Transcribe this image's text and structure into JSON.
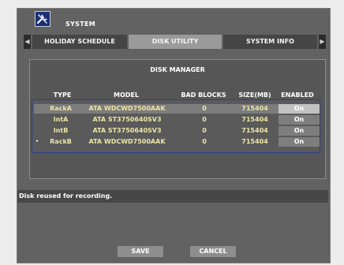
{
  "window": {
    "title": "SYSTEM",
    "icon": "tools-icon"
  },
  "tabs": [
    {
      "label": "◀",
      "icon": "tab-scroll-left-icon"
    },
    {
      "label": "HOLIDAY SCHEDULE"
    },
    {
      "label": "DISK UTILITY",
      "active": true
    },
    {
      "label": "SYSTEM INFO"
    },
    {
      "label": "▶",
      "icon": "tab-scroll-right-icon"
    }
  ],
  "panel": {
    "title": "DISK MANAGER"
  },
  "table": {
    "columns": [
      "TYPE",
      "MODEL",
      "BAD BLOCKS",
      "SIZE(MB)",
      "ENABLED"
    ],
    "rows": [
      {
        "type": "RackA",
        "model": "ATA WDCWD7500AAK",
        "bad_blocks": "0",
        "size": "715404",
        "enabled": "On"
      },
      {
        "type": "IntA",
        "model": "ATA ST3750640SV3",
        "bad_blocks": "0",
        "size": "715404",
        "enabled": "On"
      },
      {
        "type": "IntB",
        "model": "ATA ST3750640SV3",
        "bad_blocks": "0",
        "size": "715404",
        "enabled": "On"
      },
      {
        "type": "RackB",
        "model": "ATA WDCWD7500AAK",
        "bad_blocks": "0",
        "size": "715404",
        "enabled": "On",
        "cursor": "•"
      }
    ]
  },
  "status_message": "Disk reused for recording.",
  "buttons": {
    "save": "SAVE",
    "cancel": "CANCEL"
  },
  "colors": {
    "background": "#626262",
    "value_text": "#ece5a4",
    "grid_border": "#2a3f8e",
    "title_icon": "#1b2f74"
  }
}
